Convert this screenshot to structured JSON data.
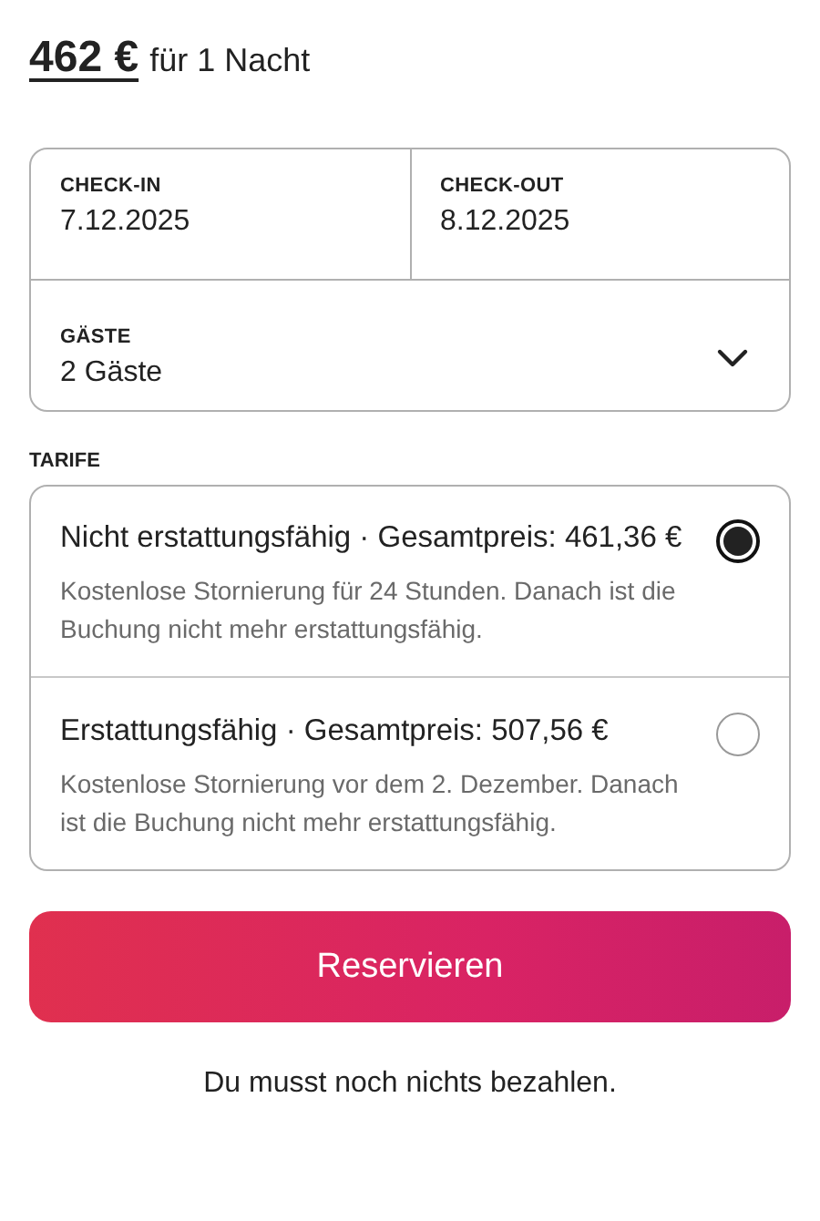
{
  "price": {
    "amount": "462 €",
    "unit": "für 1 Nacht"
  },
  "booking": {
    "check_in": {
      "label": "CHECK-IN",
      "value": "7.12.2025"
    },
    "check_out": {
      "label": "CHECK-OUT",
      "value": "8.12.2025"
    },
    "guests": {
      "label": "GÄSTE",
      "value": "2 Gäste",
      "expanded": false
    }
  },
  "rates": {
    "heading": "TARIFE",
    "options": [
      {
        "title": "Nicht erstattungsfähig · Gesamtpreis: 461,36 €",
        "description": "Kostenlose Stornierung für 24 Stunden. Danach ist die Buchung nicht mehr erstattungsfähig.",
        "selected": true
      },
      {
        "title": "Erstattungsfähig · Gesamtpreis: 507,56 €",
        "description": "Kostenlose Stornierung vor dem 2. Dezember. Danach ist die Buchung nicht mehr erstattungsfähig.",
        "selected": false
      }
    ]
  },
  "reserve_button": "Reservieren",
  "note": "Du musst noch nichts bezahlen."
}
